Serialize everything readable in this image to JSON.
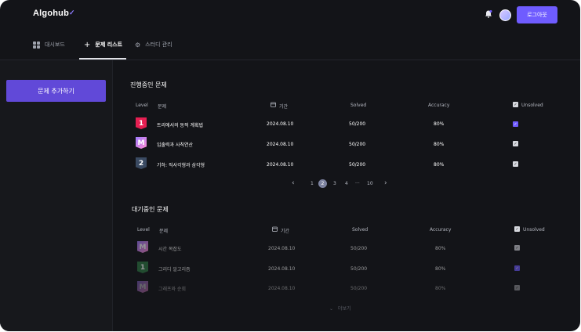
{
  "header": {
    "logo": "Algohub",
    "logout_label": "로그아웃"
  },
  "tabs": [
    {
      "label": "대시보드",
      "icon": "grid-icon"
    },
    {
      "label": "문제 리스트",
      "icon": "plus-icon"
    },
    {
      "label": "스터디 관리",
      "icon": "gear-icon"
    }
  ],
  "sidebar": {
    "add_problem_label": "문제 추가하기"
  },
  "in_progress": {
    "title": "진행중인 문제",
    "columns": {
      "level": "Level",
      "problem": "문제",
      "period": "기간",
      "solved": "Solved",
      "accuracy": "Accuracy",
      "unsolved": "Unsolved"
    },
    "rows": [
      {
        "level": "1",
        "title": "트리에서의 동적 계획법",
        "date": "2024.08.10",
        "solved": "50/200",
        "accuracy": "80%",
        "unsolved": true
      },
      {
        "level": "M",
        "title": "입출력과 사칙연산",
        "date": "2024.08.10",
        "solved": "50/200",
        "accuracy": "80%",
        "unsolved": false
      },
      {
        "level": "2",
        "title": "기하: 직사각형과 삼각형",
        "date": "2024.08.10",
        "solved": "50/200",
        "accuracy": "80%",
        "unsolved": false
      }
    ],
    "pagination": [
      "1",
      "2",
      "3",
      "4",
      "···",
      "10"
    ],
    "current_page": "2"
  },
  "waiting": {
    "title": "대기중인 문제",
    "columns": {
      "level": "Level",
      "problem": "문제",
      "period": "기간",
      "solved": "Solved",
      "accuracy": "Accuracy",
      "unsolved": "Unsolved"
    },
    "rows": [
      {
        "level": "M",
        "title": "시간 복잡도",
        "date": "2024.08.10",
        "solved": "50/200",
        "accuracy": "80%",
        "unsolved": false
      },
      {
        "level": "1",
        "title": "그리디 알고리즘",
        "date": "2024.08.10",
        "solved": "50/200",
        "accuracy": "80%",
        "unsolved": true
      },
      {
        "level": "M",
        "title": "그래프와 순회",
        "date": "2024.08.10",
        "solved": "50/200",
        "accuracy": "80%",
        "unsolved": false
      }
    ],
    "more_label": "더보기"
  }
}
